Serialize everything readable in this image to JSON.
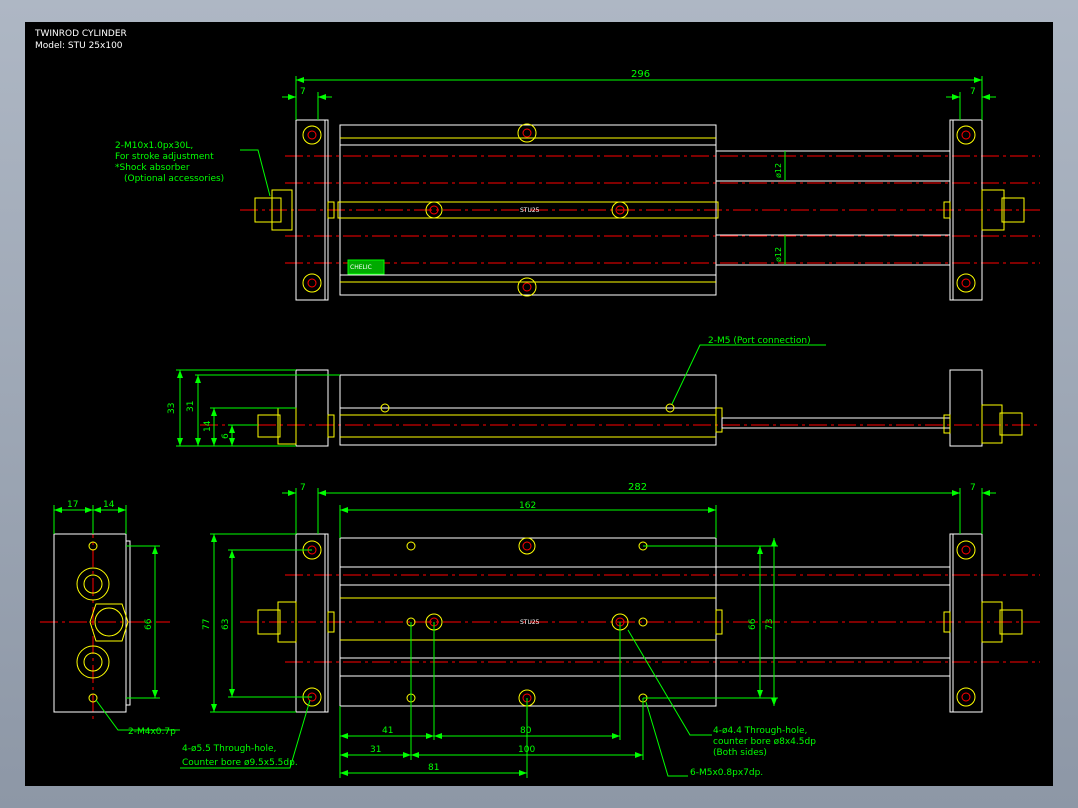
{
  "title": {
    "line1": "TWINROD CYLINDER",
    "line2": "Model: STU 25x100"
  },
  "colors": {
    "background": "#000000",
    "part_outline": "#ffffff",
    "yellow": "#ffff00",
    "dimension": "#00ff00",
    "centerline": "#ff0000",
    "label": "#00ff00"
  },
  "dimensions": {
    "top_overall": "296",
    "top_left_plate": "7",
    "top_right_plate": "7",
    "rod_dia_upper": "ø12",
    "rod_dia_lower": "ø12",
    "side_h33": "33",
    "side_h31": "31",
    "side_h14": "14",
    "side_h6": "6",
    "end_w17": "17",
    "end_w14": "14",
    "end_h66": "66",
    "bot_left_plate": "7",
    "bot_overall": "282",
    "bot_right_plate": "7",
    "bot_body": "162",
    "bot_h77": "77",
    "bot_h63": "63",
    "bot_h66": "66",
    "bot_h73": "73",
    "bot_41": "41",
    "bot_80": "80",
    "bot_31": "31",
    "bot_100": "100",
    "bot_81": "81"
  },
  "labels": {
    "stroke_adj_1": "2-M10x1.0px30L,",
    "stroke_adj_2": "For stroke adjustment",
    "stroke_adj_3": "*Shock absorber",
    "stroke_adj_4": "(Optional accessories)",
    "port": "2-M5 (Port connection)",
    "m4": "2-M4x0.7p",
    "through55_1": "4-ø5.5 Through-hole,",
    "through55_2": "Counter bore ø9.5x5.5dp.",
    "through44_1": "4-ø4.4 Through-hole,",
    "through44_2": "counter bore ø8x4.5dp",
    "through44_3": "(Both sides)",
    "m5": "6-M5x0.8px7dp.",
    "body_mark_top": "STU25",
    "body_mark_bottom": "STU25",
    "brand": "CHELIC"
  }
}
